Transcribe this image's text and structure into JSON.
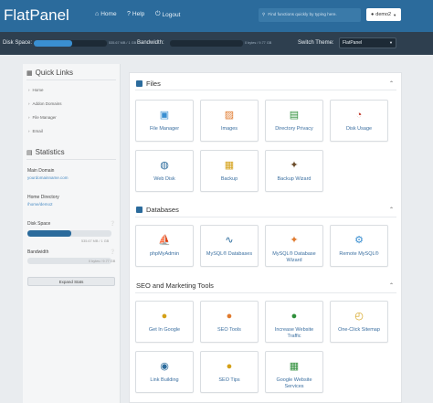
{
  "header": {
    "brand": "FlatPanel",
    "nav": [
      {
        "icon": "home-icon",
        "glyph": "⌂",
        "label": "Home"
      },
      {
        "icon": "help-icon",
        "glyph": "?",
        "label": "Help"
      },
      {
        "icon": "logout-icon",
        "glyph": "⏻",
        "label": "Logout"
      }
    ],
    "search_placeholder": "Find functions quickly by typing here.",
    "user": "demo2",
    "colors": {
      "header_bg": "#2b6b9c",
      "stats_bg": "#2e3f4f"
    }
  },
  "statsbar": {
    "disk_label": "Disk Space:",
    "disk_value": "535.67 MB / 1 GB",
    "disk_fraction": 0.52,
    "bandwidth_label": "Bandwidth:",
    "bandwidth_value": "0 bytes / 9.77 GB",
    "bandwidth_fraction": 0.0,
    "theme_label": "Switch Theme:",
    "theme_value": "FlatPanel"
  },
  "sidebar": {
    "quick_links_title": "Quick Links",
    "quick_links": [
      "Home",
      "Addon Domains",
      "File Manager",
      "Email"
    ],
    "statistics_title": "Statistics",
    "main_domain_label": "Main Domain",
    "main_domain_value": "yourdomainname.com",
    "home_dir_label": "Home Directory",
    "home_dir_value": "/home/demo2",
    "disk_label": "Disk Space",
    "disk_value": "535.67 MB / 1 GB",
    "disk_fraction": 0.52,
    "bandwidth_label": "Bandwidth",
    "bandwidth_value": "0 bytes / 9.77 GB",
    "bandwidth_fraction": 0.0,
    "expand_label": "Expand Stats"
  },
  "sections": [
    {
      "title": "Files",
      "icon": "folder-icon",
      "tiles": [
        {
          "label": "File Manager",
          "icon": "file-manager-icon",
          "glyph": "▣",
          "color": "#3a8fd1"
        },
        {
          "label": "Images",
          "icon": "images-icon",
          "glyph": "▨",
          "color": "#e07a2e"
        },
        {
          "label": "Directory Privacy",
          "icon": "directory-privacy-icon",
          "glyph": "▤",
          "color": "#2f8f3a"
        },
        {
          "label": "Disk Usage",
          "icon": "disk-usage-icon",
          "glyph": "◔",
          "color": "#c0392b"
        },
        {
          "label": "Web Disk",
          "icon": "web-disk-icon",
          "glyph": "◍",
          "color": "#2b6b9c"
        },
        {
          "label": "Backup",
          "icon": "backup-icon",
          "glyph": "▦",
          "color": "#d4a017"
        },
        {
          "label": "Backup Wizard",
          "icon": "backup-wizard-icon",
          "glyph": "✦",
          "color": "#6b4c2a"
        }
      ]
    },
    {
      "title": "Databases",
      "icon": "database-icon",
      "tiles": [
        {
          "label": "phpMyAdmin",
          "icon": "phpmyadmin-icon",
          "glyph": "⛵",
          "color": "#e07a2e"
        },
        {
          "label": "MySQL® Databases",
          "icon": "mysql-databases-icon",
          "glyph": "∿",
          "color": "#2b6b9c"
        },
        {
          "label": "MySQL® Database Wizard",
          "icon": "mysql-wizard-icon",
          "glyph": "✦",
          "color": "#e07a2e"
        },
        {
          "label": "Remote MySQL®",
          "icon": "remote-mysql-icon",
          "glyph": "⚙",
          "color": "#3a8fd1"
        }
      ]
    },
    {
      "title": "SEO and Marketing Tools",
      "icon": "seo-icon",
      "tiles": [
        {
          "label": "Get In Google",
          "icon": "get-in-google-icon",
          "glyph": "●",
          "color": "#d4a017"
        },
        {
          "label": "SEO Tools",
          "icon": "seo-tools-icon",
          "glyph": "●",
          "color": "#e07a2e"
        },
        {
          "label": "Increase Website Traffic",
          "icon": "traffic-light-icon",
          "glyph": "●",
          "color": "#2f8f3a"
        },
        {
          "label": "One-Click Sitemap",
          "icon": "sitemap-icon",
          "glyph": "◴",
          "color": "#d4a017"
        },
        {
          "label": "Link Building",
          "icon": "link-building-icon",
          "glyph": "◉",
          "color": "#2b6b9c"
        },
        {
          "label": "SEO Tips",
          "icon": "seo-tips-icon",
          "glyph": "●",
          "color": "#d4a017"
        },
        {
          "label": "Google Website Services",
          "icon": "google-services-icon",
          "glyph": "▦",
          "color": "#2f8f3a"
        }
      ]
    }
  ]
}
